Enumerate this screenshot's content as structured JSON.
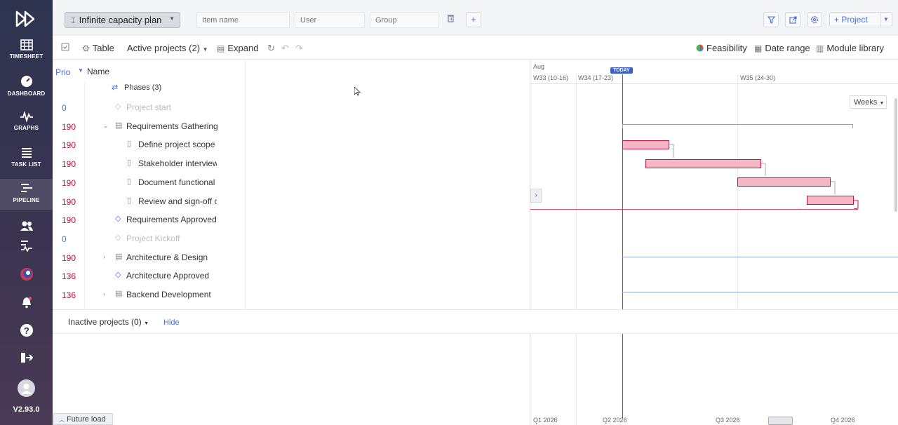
{
  "sidebar": {
    "items": [
      {
        "label": "TIMESHEET",
        "icon": "table-icon"
      },
      {
        "label": "DASHBOARD",
        "icon": "gauge-icon"
      },
      {
        "label": "GRAPHS",
        "icon": "pulse-icon"
      },
      {
        "label": "TASK LIST",
        "icon": "list-icon"
      },
      {
        "label": "PIPELINE",
        "icon": "pipeline-icon"
      }
    ],
    "version": "V2.93.0"
  },
  "toolbar": {
    "plan": "Infinite capacity plan",
    "item_name_placeholder": "Item name",
    "user_placeholder": "User",
    "group_placeholder": "Group",
    "add_label": "+",
    "project_label": "+ Project"
  },
  "toolbar2": {
    "table": "Table",
    "active_projects": "Active projects (2)",
    "expand": "Expand",
    "feasibility": "Feasibility",
    "date_range": "Date range",
    "module_library": "Module library"
  },
  "table": {
    "prio_header": "Prio",
    "name_header": "Name",
    "phases": "Phases (3)",
    "rows": [
      {
        "prio": "0",
        "name": "Project start",
        "type": "milestone",
        "indent": 1,
        "faded": true
      },
      {
        "prio": "190",
        "name": "Requirements Gathering",
        "type": "group",
        "indent": 1,
        "faded": false
      },
      {
        "prio": "190",
        "name": "Define project scope",
        "type": "task",
        "indent": 2,
        "faded": false
      },
      {
        "prio": "190",
        "name": "Stakeholder interviews",
        "type": "task",
        "indent": 2,
        "faded": false
      },
      {
        "prio": "190",
        "name": "Document functional",
        "type": "task",
        "indent": 2,
        "faded": false
      },
      {
        "prio": "190",
        "name": "Review and sign-off on",
        "type": "task",
        "indent": 2,
        "faded": false
      },
      {
        "prio": "190",
        "name": "Requirements Approved",
        "type": "milestone",
        "indent": 1,
        "faded": false
      },
      {
        "prio": "0",
        "name": "Project Kickoff",
        "type": "milestone",
        "indent": 1,
        "faded": true
      },
      {
        "prio": "190",
        "name": "Architecture & Design",
        "type": "group",
        "indent": 1,
        "faded": false
      },
      {
        "prio": "136",
        "name": "Architecture Approved",
        "type": "milestone",
        "indent": 1,
        "faded": false
      },
      {
        "prio": "136",
        "name": "Backend Development",
        "type": "group",
        "indent": 1,
        "faded": false
      }
    ]
  },
  "gantt": {
    "month": "Aug",
    "today": "TODAY",
    "weeks": [
      "W33 (10-16)",
      "W34 (17-23)",
      "W35 (24-30)"
    ],
    "scale": "Weeks",
    "quarters": [
      "Q1 2026",
      "Q2 2026",
      "Q3 2026",
      "Q4 2026"
    ]
  },
  "inactive": {
    "label": "Inactive projects (0)",
    "hide": "Hide"
  },
  "future_load": "Future load",
  "colors": {
    "accent": "#4a6fd0",
    "bar": "#f7b6c6",
    "bar_border": "#c0143c",
    "today": "#3a5fc8"
  }
}
